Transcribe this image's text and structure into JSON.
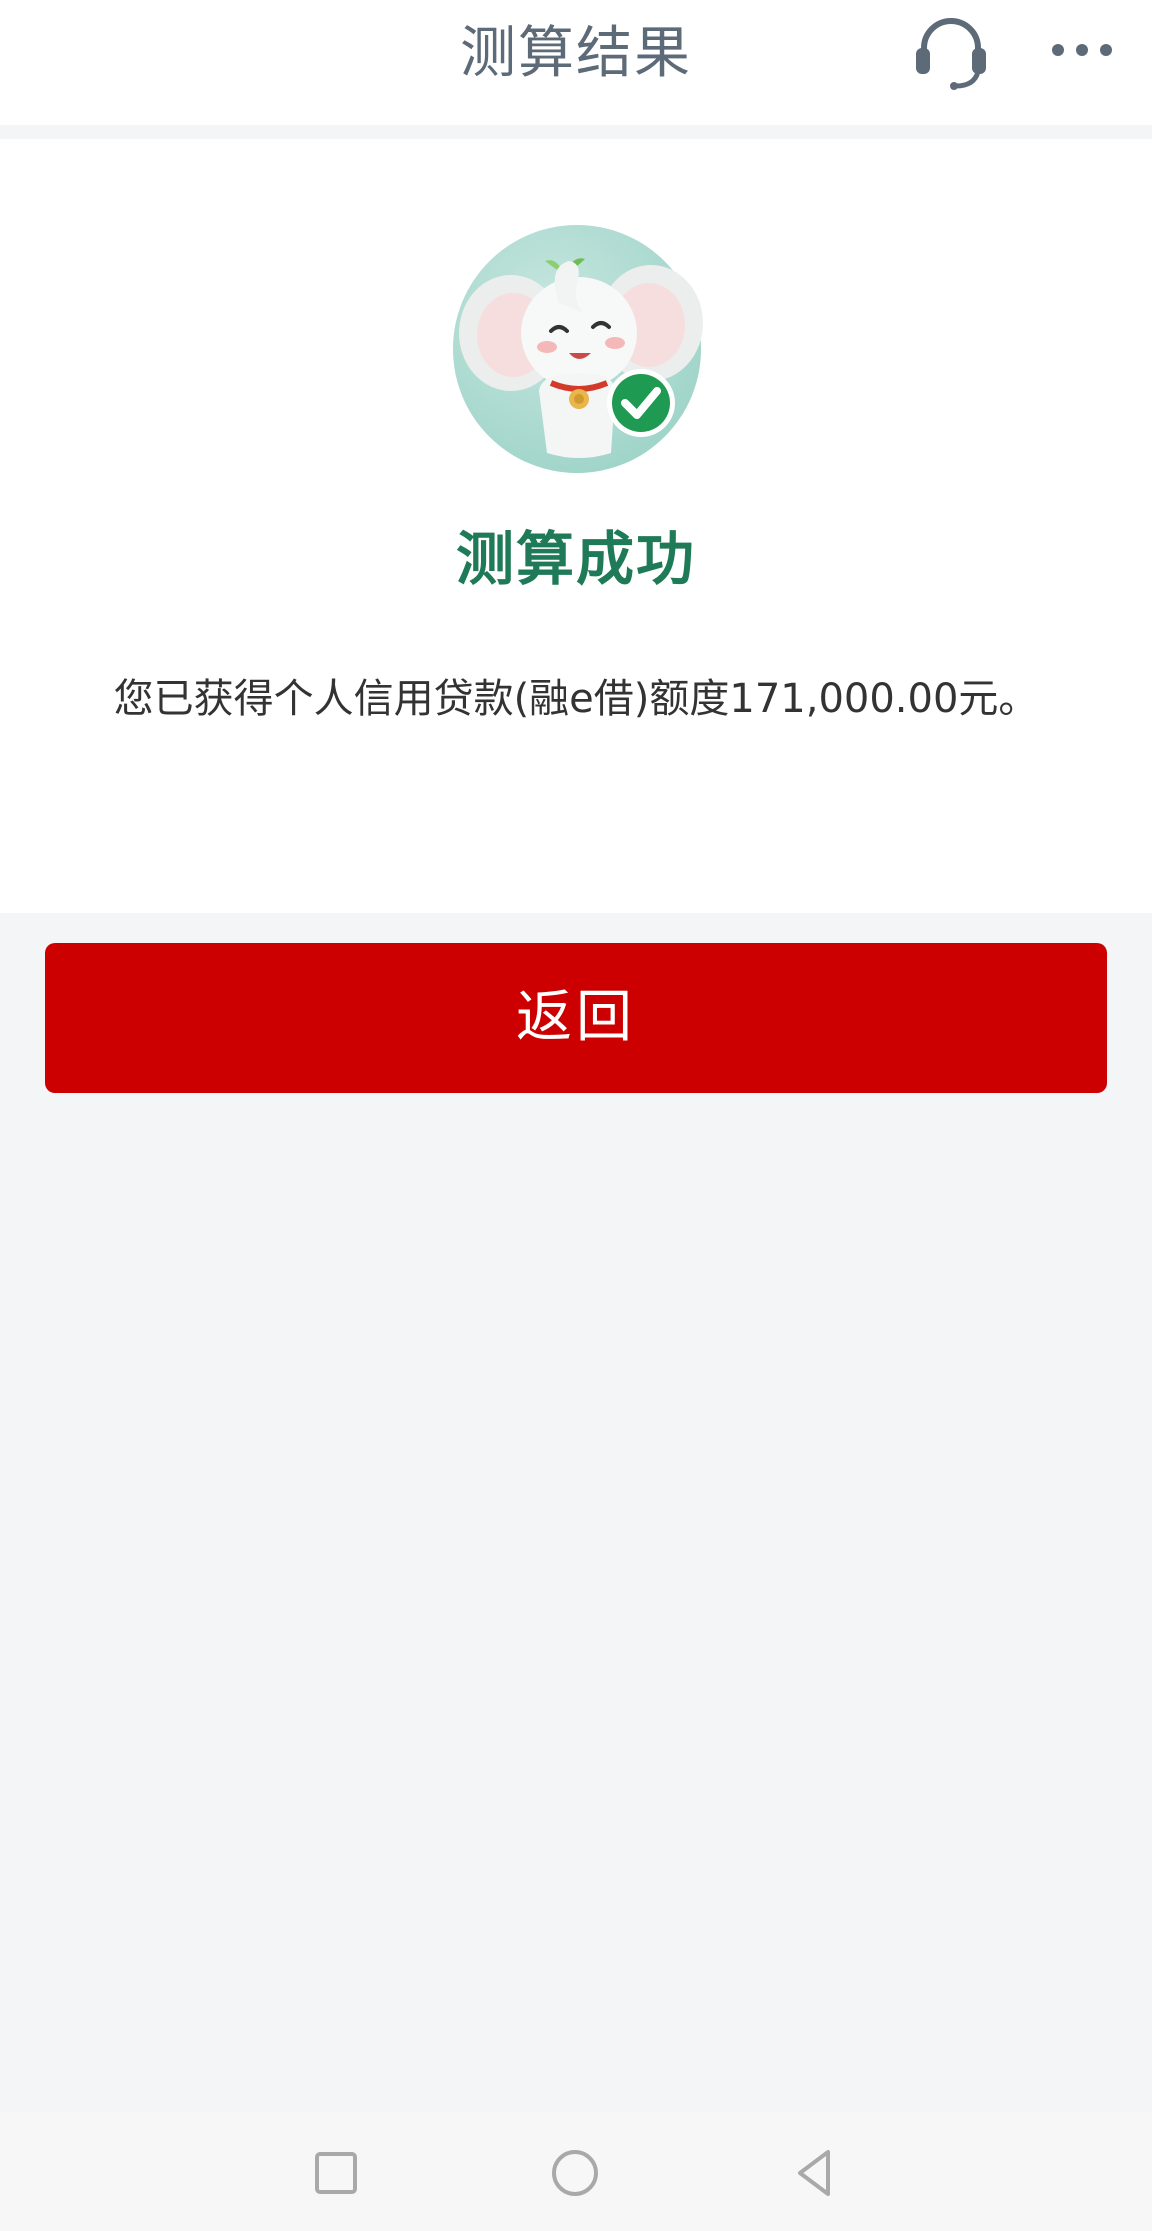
{
  "header": {
    "title": "测算结果",
    "icons": [
      "headset-icon",
      "more-icon"
    ]
  },
  "result": {
    "mascot": "elephant-mascot-with-check",
    "status_title": "测算成功",
    "status_text": "您已获得个人信用贷款(融e借)额度171,000.00元。"
  },
  "actions": {
    "back_label": "返回"
  },
  "colors": {
    "title_gray": "#5d6a78",
    "success_green": "#1f7a57",
    "button_red": "#cc0000",
    "page_bg": "#f4f5f7"
  },
  "system_nav": [
    "recents-icon",
    "home-icon",
    "back-icon"
  ]
}
